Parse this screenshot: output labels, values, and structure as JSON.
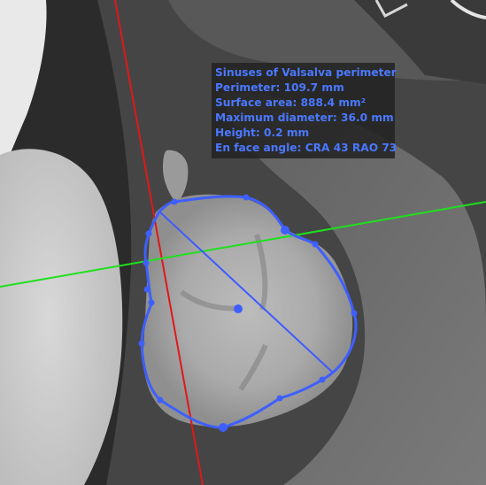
{
  "annotation": {
    "title": "Sinuses of Valsalva perimeter",
    "lines": [
      "Perimeter: 109.7 mm",
      "Surface area: 888.4 mm²",
      "Maximum diameter: 36.0 mm",
      "Height: 0.2 mm",
      "En face angle: CRA  43 RAO  73"
    ]
  },
  "colors": {
    "annotation_text": "#4a78ff",
    "contour": "#3e5fff",
    "red_axis": "#e01818",
    "green_axis": "#1ee01e",
    "diameter_line": "#3f5bff"
  }
}
